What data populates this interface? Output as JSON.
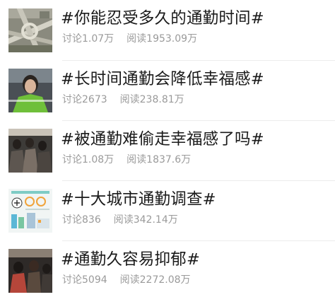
{
  "topics": [
    {
      "title": "#你能忍受多久的通勤时间#",
      "discuss_label": "讨论",
      "discuss_count": "1.07万",
      "read_label": "阅读",
      "read_count": "1953.09万",
      "thumbnail": "overpass-traffic-photo"
    },
    {
      "title": "#长时间通勤会降低幸福感#",
      "discuss_label": "讨论",
      "discuss_count": "2673",
      "read_label": "阅读",
      "read_count": "238.81万",
      "thumbnail": "woman-green-jacket-photo"
    },
    {
      "title": "#被通勤难偷走幸福感了吗#",
      "discuss_label": "讨论",
      "discuss_count": "1.08万",
      "read_label": "阅读",
      "read_count": "1837.6万",
      "thumbnail": "crowded-subway-photo"
    },
    {
      "title": "#十大城市通勤调查#",
      "discuss_label": "讨论",
      "discuss_count": "836",
      "read_label": "阅读",
      "read_count": "342.14万",
      "thumbnail": "commute-infographic"
    },
    {
      "title": "#通勤久容易抑郁#",
      "discuss_label": "讨论",
      "discuss_count": "5094",
      "read_label": "阅读",
      "read_count": "2272.08万",
      "thumbnail": "crowd-people-photo"
    }
  ]
}
